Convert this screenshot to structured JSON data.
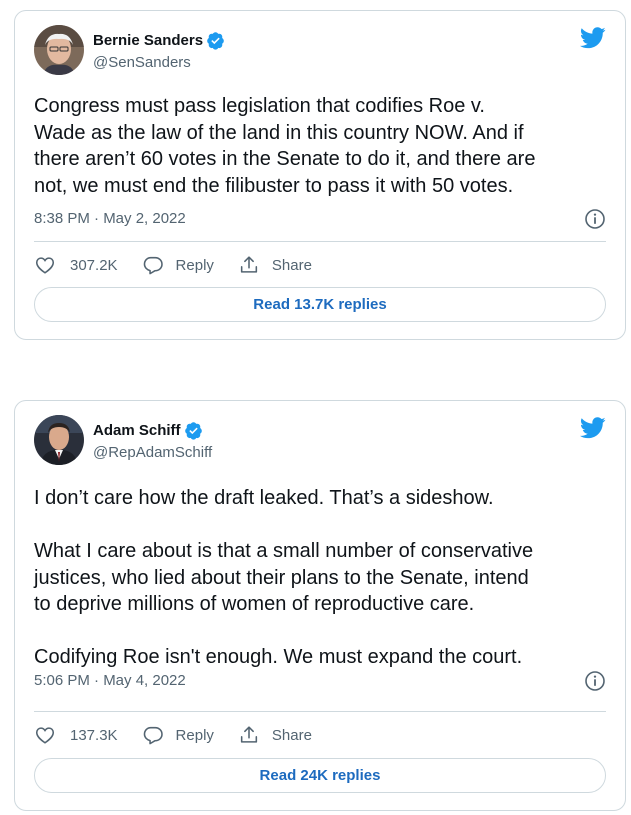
{
  "colors": {
    "brand_blue": "#1d9bf0",
    "link_blue": "#1d6bbf",
    "text": "#0f1419",
    "muted": "#536471",
    "border": "#cfd9de"
  },
  "tweets": [
    {
      "author": {
        "name": "Bernie Sanders",
        "handle": "@SenSanders",
        "verified": true
      },
      "text": "Congress must pass legislation that codifies Roe v.\nWade as the law of the land in this country NOW. And if\nthere aren’t 60 votes in the Senate to do it, and there are\nnot, we must end the filibuster to pass it with 50 votes.",
      "timestamp": "8:38 PM · May 2, 2022",
      "likes": "307.2K",
      "reply_label": "Reply",
      "share_label": "Share",
      "read_replies": "Read 13.7K replies"
    },
    {
      "author": {
        "name": "Adam Schiff",
        "handle": "@RepAdamSchiff",
        "verified": true
      },
      "text": "I don’t care how the draft leaked. That’s a sideshow.\n\nWhat I care about is that a small number of conservative\njustices, who lied about their plans to the Senate, intend\nto deprive millions of women of reproductive care.\n\nCodifying Roe isn't enough. We must expand the court.",
      "timestamp": "5:06 PM · May 4, 2022",
      "likes": "137.3K",
      "reply_label": "Reply",
      "share_label": "Share",
      "read_replies": "Read 24K replies"
    }
  ]
}
